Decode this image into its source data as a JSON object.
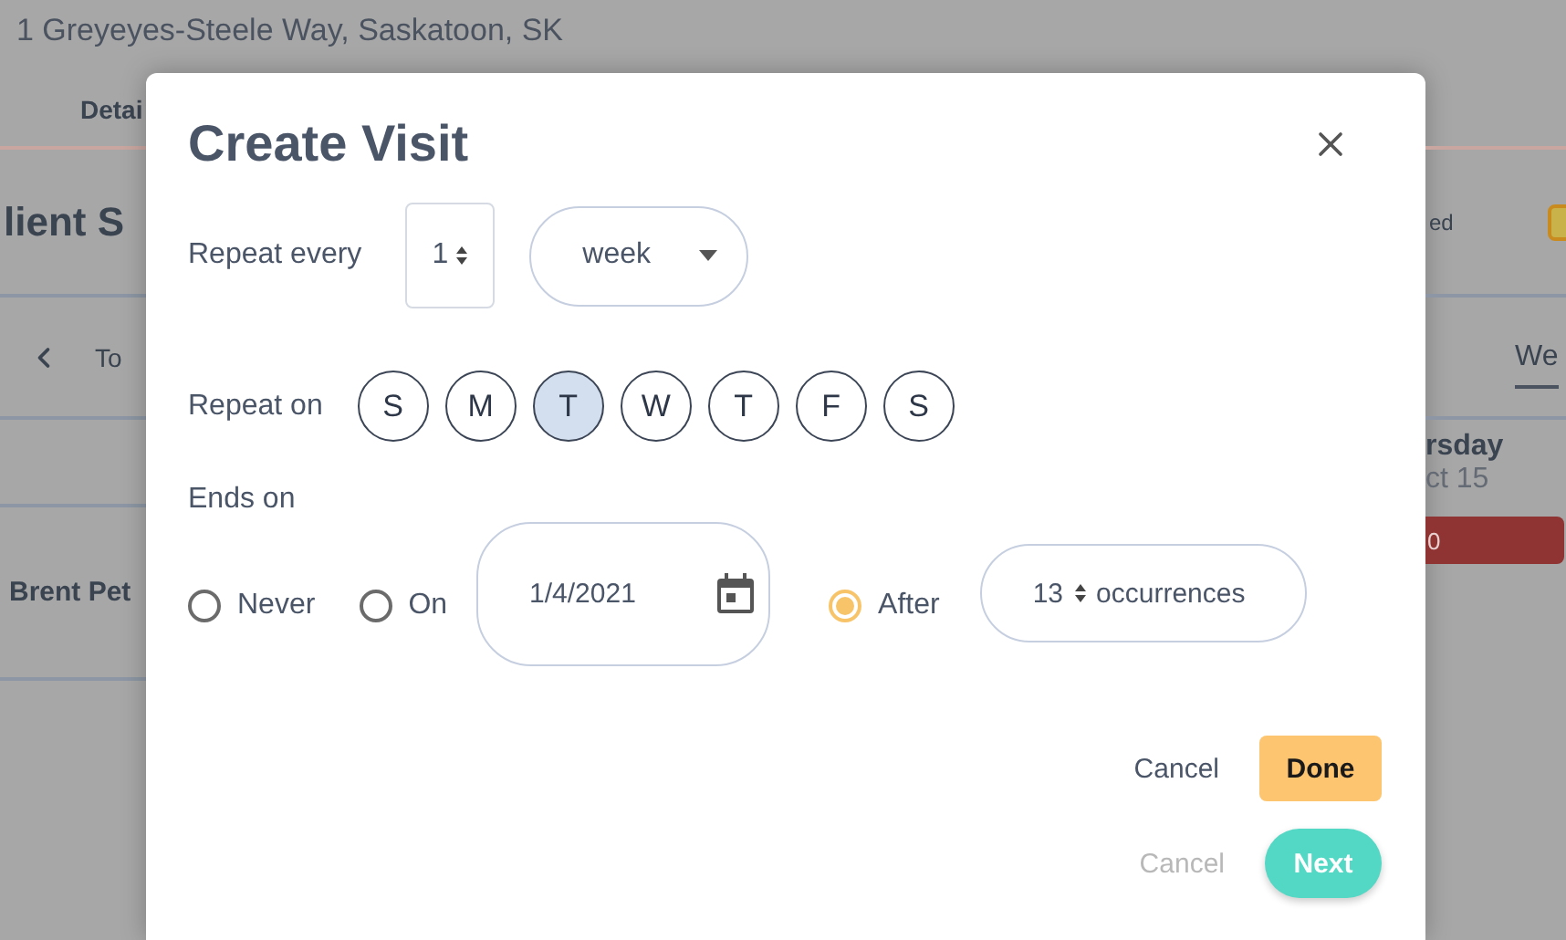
{
  "background": {
    "address": "1 Greyeyes-Steele Way, Saskatoon, SK",
    "tab": "Detai",
    "section_title": "lient S",
    "today": "To",
    "row_name": "Brent Pet",
    "legend_label": "ed",
    "legend_checked": false,
    "view_tab": "We",
    "day_name": "rsday",
    "day_date": "ct 15",
    "event_label": "0"
  },
  "modal": {
    "title": "Create Visit",
    "repeat_every": {
      "label": "Repeat every",
      "count": "1",
      "unit": "week"
    },
    "repeat_on": {
      "label": "Repeat on",
      "days": [
        {
          "label": "S",
          "selected": false
        },
        {
          "label": "M",
          "selected": false
        },
        {
          "label": "T",
          "selected": true
        },
        {
          "label": "W",
          "selected": false
        },
        {
          "label": "T",
          "selected": false
        },
        {
          "label": "F",
          "selected": false
        },
        {
          "label": "S",
          "selected": false
        }
      ]
    },
    "ends_on": {
      "label": "Ends on",
      "options": [
        {
          "kind": "plain",
          "label": "Never",
          "selected": false
        },
        {
          "kind": "date",
          "label": "On",
          "selected": false,
          "value": "1/4/2021"
        },
        {
          "kind": "count",
          "label": "After",
          "selected": true,
          "value": "13",
          "unit": "occurrences"
        }
      ]
    },
    "button_rows": [
      [
        {
          "label": "Cancel",
          "kind": "text",
          "disabled": false
        },
        {
          "label": "Done",
          "kind": "primary"
        }
      ],
      [
        {
          "label": "Cancel",
          "kind": "text",
          "disabled": true
        },
        {
          "label": "Next",
          "kind": "pill"
        }
      ]
    ]
  }
}
